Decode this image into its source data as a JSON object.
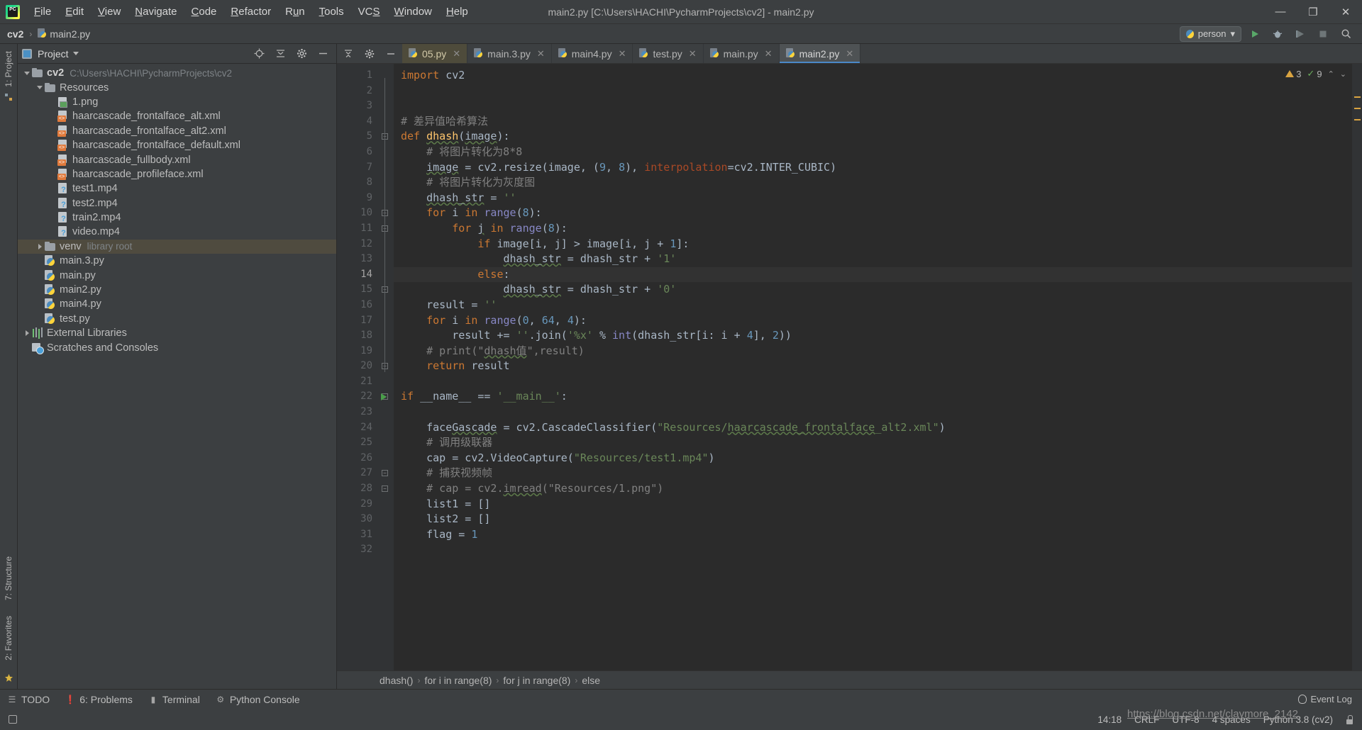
{
  "window": {
    "title": "main2.py [C:\\Users\\HACHI\\PycharmProjects\\cv2] - main2.py",
    "minimize": "—",
    "maximize": "❐",
    "close": "✕",
    "logo_text": "PC"
  },
  "menubar": [
    {
      "label": "File"
    },
    {
      "label": "Edit"
    },
    {
      "label": "View"
    },
    {
      "label": "Navigate"
    },
    {
      "label": "Code"
    },
    {
      "label": "Refactor"
    },
    {
      "label": "Run"
    },
    {
      "label": "Tools"
    },
    {
      "label": "VCS"
    },
    {
      "label": "Window"
    },
    {
      "label": "Help"
    }
  ],
  "breadcrumb": {
    "project": "cv2",
    "file": "main2.py",
    "separator": "›"
  },
  "toolbar": {
    "run_config": "person",
    "run_icon": "run-icon",
    "debug_icon": "debug-icon",
    "coverage_icon": "coverage-icon",
    "stop_icon": "stop-icon",
    "search_icon": "search-icon",
    "dropdown_arrow": "▾"
  },
  "left_rail": {
    "top_label": "1: Project",
    "labels": [
      "7: Structure",
      "2: Favorites"
    ],
    "star_icon": "favorites-star-icon"
  },
  "project_panel": {
    "title": "Project",
    "icons": [
      "target-icon",
      "collapse-all-icon",
      "settings-gear-icon",
      "hide-icon"
    ],
    "tree": [
      {
        "depth": 0,
        "arrow": "open",
        "icon": "folder",
        "label": "cv2",
        "bold": true,
        "sub": "C:\\Users\\HACHI\\PycharmProjects\\cv2",
        "selected": false
      },
      {
        "depth": 1,
        "arrow": "open",
        "icon": "folder",
        "label": "Resources",
        "bold": false,
        "sub": "",
        "selected": false
      },
      {
        "depth": 2,
        "arrow": "none",
        "icon": "png",
        "label": "1.png",
        "bold": false,
        "sub": "",
        "selected": false
      },
      {
        "depth": 2,
        "arrow": "none",
        "icon": "xml",
        "label": "haarcascade_frontalface_alt.xml",
        "bold": false,
        "sub": "",
        "selected": false
      },
      {
        "depth": 2,
        "arrow": "none",
        "icon": "xml",
        "label": "haarcascade_frontalface_alt2.xml",
        "bold": false,
        "sub": "",
        "selected": false
      },
      {
        "depth": 2,
        "arrow": "none",
        "icon": "xml",
        "label": "haarcascade_frontalface_default.xml",
        "bold": false,
        "sub": "",
        "selected": false
      },
      {
        "depth": 2,
        "arrow": "none",
        "icon": "xml",
        "label": "haarcascade_fullbody.xml",
        "bold": false,
        "sub": "",
        "selected": false
      },
      {
        "depth": 2,
        "arrow": "none",
        "icon": "xml",
        "label": "haarcascade_profileface.xml",
        "bold": false,
        "sub": "",
        "selected": false
      },
      {
        "depth": 2,
        "arrow": "none",
        "icon": "mp4",
        "label": "test1.mp4",
        "bold": false,
        "sub": "",
        "selected": false
      },
      {
        "depth": 2,
        "arrow": "none",
        "icon": "mp4",
        "label": "test2.mp4",
        "bold": false,
        "sub": "",
        "selected": false
      },
      {
        "depth": 2,
        "arrow": "none",
        "icon": "mp4",
        "label": "train2.mp4",
        "bold": false,
        "sub": "",
        "selected": false
      },
      {
        "depth": 2,
        "arrow": "none",
        "icon": "mp4",
        "label": "video.mp4",
        "bold": false,
        "sub": "",
        "selected": false
      },
      {
        "depth": 1,
        "arrow": "closed",
        "icon": "folder",
        "label": "venv",
        "bold": false,
        "sub": "library root",
        "selected": true
      },
      {
        "depth": 1,
        "arrow": "none",
        "icon": "py",
        "label": "main.3.py",
        "bold": false,
        "sub": "",
        "selected": false
      },
      {
        "depth": 1,
        "arrow": "none",
        "icon": "py",
        "label": "main.py",
        "bold": false,
        "sub": "",
        "selected": false
      },
      {
        "depth": 1,
        "arrow": "none",
        "icon": "py",
        "label": "main2.py",
        "bold": false,
        "sub": "",
        "selected": false
      },
      {
        "depth": 1,
        "arrow": "none",
        "icon": "py",
        "label": "main4.py",
        "bold": false,
        "sub": "",
        "selected": false
      },
      {
        "depth": 1,
        "arrow": "none",
        "icon": "py",
        "label": "test.py",
        "bold": false,
        "sub": "",
        "selected": false
      },
      {
        "depth": 0,
        "arrow": "closed",
        "icon": "lib",
        "label": "External Libraries",
        "bold": false,
        "sub": "",
        "selected": false
      },
      {
        "depth": 0,
        "arrow": "none",
        "icon": "scratch",
        "label": "Scratches and Consoles",
        "bold": false,
        "sub": "",
        "selected": false
      }
    ]
  },
  "editor": {
    "tabs": [
      {
        "label": "05.py",
        "state": "highlight"
      },
      {
        "label": "main.3.py",
        "state": "normal"
      },
      {
        "label": "main4.py",
        "state": "normal"
      },
      {
        "label": "test.py",
        "state": "normal"
      },
      {
        "label": "main.py",
        "state": "normal"
      },
      {
        "label": "main2.py",
        "state": "active"
      }
    ],
    "tab_close": "✕",
    "inspection": {
      "warnings": "3",
      "weak_warnings": "9",
      "up_arrow": "⌃",
      "down_arrow": "⌄"
    },
    "crumbs": [
      "dhash()",
      "for i in range(8)",
      "for j in range(8)",
      "else"
    ],
    "crumb_separator": "›",
    "current_line": 14,
    "lines": [
      {
        "n": 1,
        "fold": "",
        "html": "<span class=\"kw\">import</span> cv2"
      },
      {
        "n": 2,
        "fold": "",
        "html": ""
      },
      {
        "n": 3,
        "fold": "",
        "html": ""
      },
      {
        "n": 4,
        "fold": "",
        "html": "<span class=\"com\"># 差异值哈希算法</span>"
      },
      {
        "n": 5,
        "fold": "minus",
        "html": "<span class=\"kw\">def</span> <span class=\"fn varu\">dhash</span>(<span class=\"varu\">image</span>):"
      },
      {
        "n": 6,
        "fold": "",
        "html": "    <span class=\"com\"># 将图片转化为8*8</span>"
      },
      {
        "n": 7,
        "fold": "",
        "html": "    <span class=\"varu\">image</span> = cv2.resize(image, (<span class=\"num\">9</span>, <span class=\"num\">8</span>), <span class=\"named\">interpolation</span>=cv2.INTER_CUBIC)"
      },
      {
        "n": 8,
        "fold": "",
        "html": "    <span class=\"com\"># 将图片转化为灰度图</span>"
      },
      {
        "n": 9,
        "fold": "",
        "html": "    <span class=\"varu\">dhash_str</span> = <span class=\"str\">''</span>"
      },
      {
        "n": 10,
        "fold": "minus",
        "html": "    <span class=\"kw\">for</span> i <span class=\"kw\">in</span> <span class=\"builtin\">range</span>(<span class=\"num\">8</span>):"
      },
      {
        "n": 11,
        "fold": "minus",
        "html": "        <span class=\"kw\">for</span> <span class=\"varu\">j</span> <span class=\"kw\">in</span> <span class=\"builtin\">range</span>(<span class=\"num\">8</span>):"
      },
      {
        "n": 12,
        "fold": "",
        "html": "            <span class=\"kw\">if</span> image[i, j] &gt; image[i, j + <span class=\"num\">1</span>]:"
      },
      {
        "n": 13,
        "fold": "",
        "html": "                <span class=\"varu\">dhash_str</span> = dhash_str + <span class=\"str\">'1'</span>"
      },
      {
        "n": 14,
        "fold": "",
        "html": "            <span class=\"kw\">else</span>:"
      },
      {
        "n": 15,
        "fold": "plus",
        "html": "                <span class=\"varu\">dhash_str</span> = dhash_str + <span class=\"str\">'0'</span>"
      },
      {
        "n": 16,
        "fold": "",
        "html": "    result = <span class=\"str\">''</span>"
      },
      {
        "n": 17,
        "fold": "",
        "html": "    <span class=\"kw\">for</span> i <span class=\"kw\">in</span> <span class=\"builtin\">range</span>(<span class=\"num\">0</span>, <span class=\"num\">64</span>, <span class=\"num\">4</span>):"
      },
      {
        "n": 18,
        "fold": "",
        "html": "        result += <span class=\"str\">''</span>.join(<span class=\"str\">'%x'</span> % <span class=\"builtin\">int</span>(dhash_str[i: i + <span class=\"num\">4</span>], <span class=\"num\">2</span>))"
      },
      {
        "n": 19,
        "fold": "",
        "html": "    <span class=\"com\"># print(\"<span class=\"varu\">dhash值</span>\",result)</span>"
      },
      {
        "n": 20,
        "fold": "plus",
        "html": "    <span class=\"kw\">return</span> result"
      },
      {
        "n": 21,
        "fold": "",
        "html": ""
      },
      {
        "n": 22,
        "fold": "minus",
        "run": true,
        "html": "<span class=\"kw\">if</span> __name__ == <span class=\"str\">'__main__'</span>:"
      },
      {
        "n": 23,
        "fold": "",
        "html": ""
      },
      {
        "n": 24,
        "fold": "",
        "html": "    face<span class=\"varu\">Gascade</span> = cv2.CascadeClassifier(<span class=\"str\">\"Resources/<span class=\"varu\">haarcascade_frontalface</span>_alt2.xml\"</span>)"
      },
      {
        "n": 25,
        "fold": "",
        "html": "    <span class=\"com\"># 调用级联器</span>"
      },
      {
        "n": 26,
        "fold": "",
        "html": "    cap = cv2.VideoCapture(<span class=\"str\">\"Resources/test1.mp4\"</span>)"
      },
      {
        "n": 27,
        "fold": "minus",
        "html": "    <span class=\"com\"># 捕获视频帧</span>"
      },
      {
        "n": 28,
        "fold": "plus",
        "html": "    <span class=\"com\"># cap = cv2.<span class=\"varu\">imread</span>(\"Resources/1.png\")</span>"
      },
      {
        "n": 29,
        "fold": "",
        "html": "    list1 = []"
      },
      {
        "n": 30,
        "fold": "",
        "html": "    list2 = []"
      },
      {
        "n": 31,
        "fold": "",
        "html": "    flag = <span class=\"num\">1</span>"
      },
      {
        "n": 32,
        "fold": "",
        "html": ""
      }
    ]
  },
  "bottom_bar": {
    "items": [
      {
        "label": "TODO",
        "icon": "todo-icon"
      },
      {
        "label": "6: Problems",
        "icon": "problems-icon"
      },
      {
        "label": "Terminal",
        "icon": "terminal-icon"
      },
      {
        "label": "Python Console",
        "icon": "python-console-icon"
      }
    ],
    "event_log": "Event Log"
  },
  "status_bar": {
    "time": "14:18",
    "line_ending": "CRLF",
    "encoding": "UTF-8",
    "indent": "4 spaces",
    "interpreter": "Python 3.8 (cv2)",
    "lock_icon": "lock-icon",
    "watermark": "https://blog.csdn.net/claymore_2142"
  },
  "colors": {
    "accent": "#4a88c7",
    "bg": "#3c3f41",
    "editor_bg": "#2b2b2b",
    "gutter_bg": "#313335",
    "selection": "#4f4b3f",
    "keyword": "#cc7832",
    "string": "#6a8759",
    "number": "#6897bb",
    "comment": "#808080",
    "function": "#ffc66d"
  }
}
